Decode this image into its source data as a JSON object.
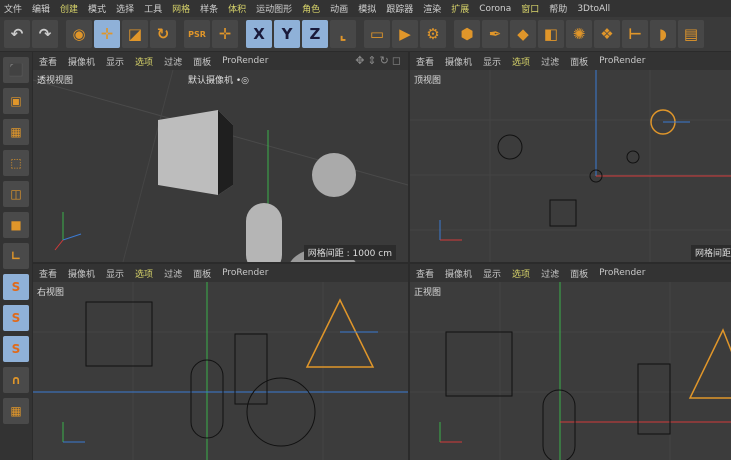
{
  "menu": [
    "文件",
    "编辑",
    "创建",
    "模式",
    "选择",
    "工具",
    "网格",
    "样条",
    "体积",
    "运动图形",
    "角色",
    "动画",
    "模拟",
    "跟踪器",
    "渲染",
    "扩展",
    "Corona",
    "窗口",
    "帮助",
    "3DtoAll"
  ],
  "toolbar": [
    {
      "icon": "undo-icon",
      "glyph": "↶"
    },
    {
      "icon": "redo-icon",
      "glyph": "↷"
    },
    {
      "icon": "select-icon",
      "glyph": "◉"
    },
    {
      "icon": "move-icon",
      "glyph": "✛",
      "selected": true
    },
    {
      "icon": "scale-icon",
      "glyph": "◪"
    },
    {
      "icon": "rotate-icon",
      "glyph": "↻"
    },
    {
      "icon": "psr-icon",
      "glyph": "PSR"
    },
    {
      "icon": "axis-icon",
      "glyph": "✛"
    },
    {
      "icon": "x-axis-icon",
      "glyph": "X",
      "selected": true
    },
    {
      "icon": "y-axis-icon",
      "glyph": "Y",
      "selected": true
    },
    {
      "icon": "z-axis-icon",
      "glyph": "Z",
      "selected": true
    },
    {
      "icon": "world-coord-icon",
      "glyph": "⌞"
    },
    {
      "icon": "render-view-icon",
      "glyph": "▭"
    },
    {
      "icon": "render-picture-viewer-icon",
      "glyph": "▶"
    },
    {
      "icon": "render-settings-icon",
      "glyph": "⚙"
    },
    {
      "icon": "cube-icon",
      "glyph": "⬢"
    },
    {
      "icon": "pen-icon",
      "glyph": "✒"
    },
    {
      "icon": "subdivision-icon",
      "glyph": "◆"
    },
    {
      "icon": "extrude-icon",
      "glyph": "◧"
    },
    {
      "icon": "cloner-icon",
      "glyph": "✺"
    },
    {
      "icon": "mograph-icon",
      "glyph": "❖"
    },
    {
      "icon": "deformer-icon",
      "glyph": "⊢"
    },
    {
      "icon": "field-icon",
      "glyph": "◗"
    },
    {
      "icon": "floor-icon",
      "glyph": "▤"
    }
  ],
  "left_toolbar": [
    {
      "icon": "make-editable-icon",
      "glyph": "⬛"
    },
    {
      "icon": "model-mode-icon",
      "glyph": "▣"
    },
    {
      "icon": "texture-mode-icon",
      "glyph": "▦"
    },
    {
      "icon": "points-mode-icon",
      "glyph": "⬚"
    },
    {
      "icon": "edges-mode-icon",
      "glyph": "◫"
    },
    {
      "icon": "polygons-mode-icon",
      "glyph": "■"
    },
    {
      "icon": "axis-mode-icon",
      "glyph": "∟"
    },
    {
      "icon": "snap-icon",
      "glyph": "S"
    },
    {
      "icon": "snap-settings-icon",
      "glyph": "S"
    },
    {
      "icon": "snap-3d-icon",
      "glyph": "S"
    },
    {
      "icon": "magnet-icon",
      "glyph": "∩"
    },
    {
      "icon": "workplane-icon",
      "glyph": "▦"
    }
  ],
  "viewport_menu": [
    "查看",
    "摄像机",
    "显示",
    "选项",
    "过滤",
    "面板",
    "ProRender"
  ],
  "viewport_menu_highlight": "选项",
  "viewports": [
    {
      "name": "透视视图",
      "camera": "默认摄像机 •◎",
      "grid": "网格间距 : 1000 cm"
    },
    {
      "name": "顶视图",
      "grid": "网格间距"
    },
    {
      "name": "右视图"
    },
    {
      "name": "正视图"
    }
  ],
  "colors": {
    "accent": "#d7d36a",
    "x_axis": "#d23a3a",
    "y_axis": "#3ab04a",
    "z_axis": "#3a7ad2",
    "selection": "#e0962a"
  }
}
